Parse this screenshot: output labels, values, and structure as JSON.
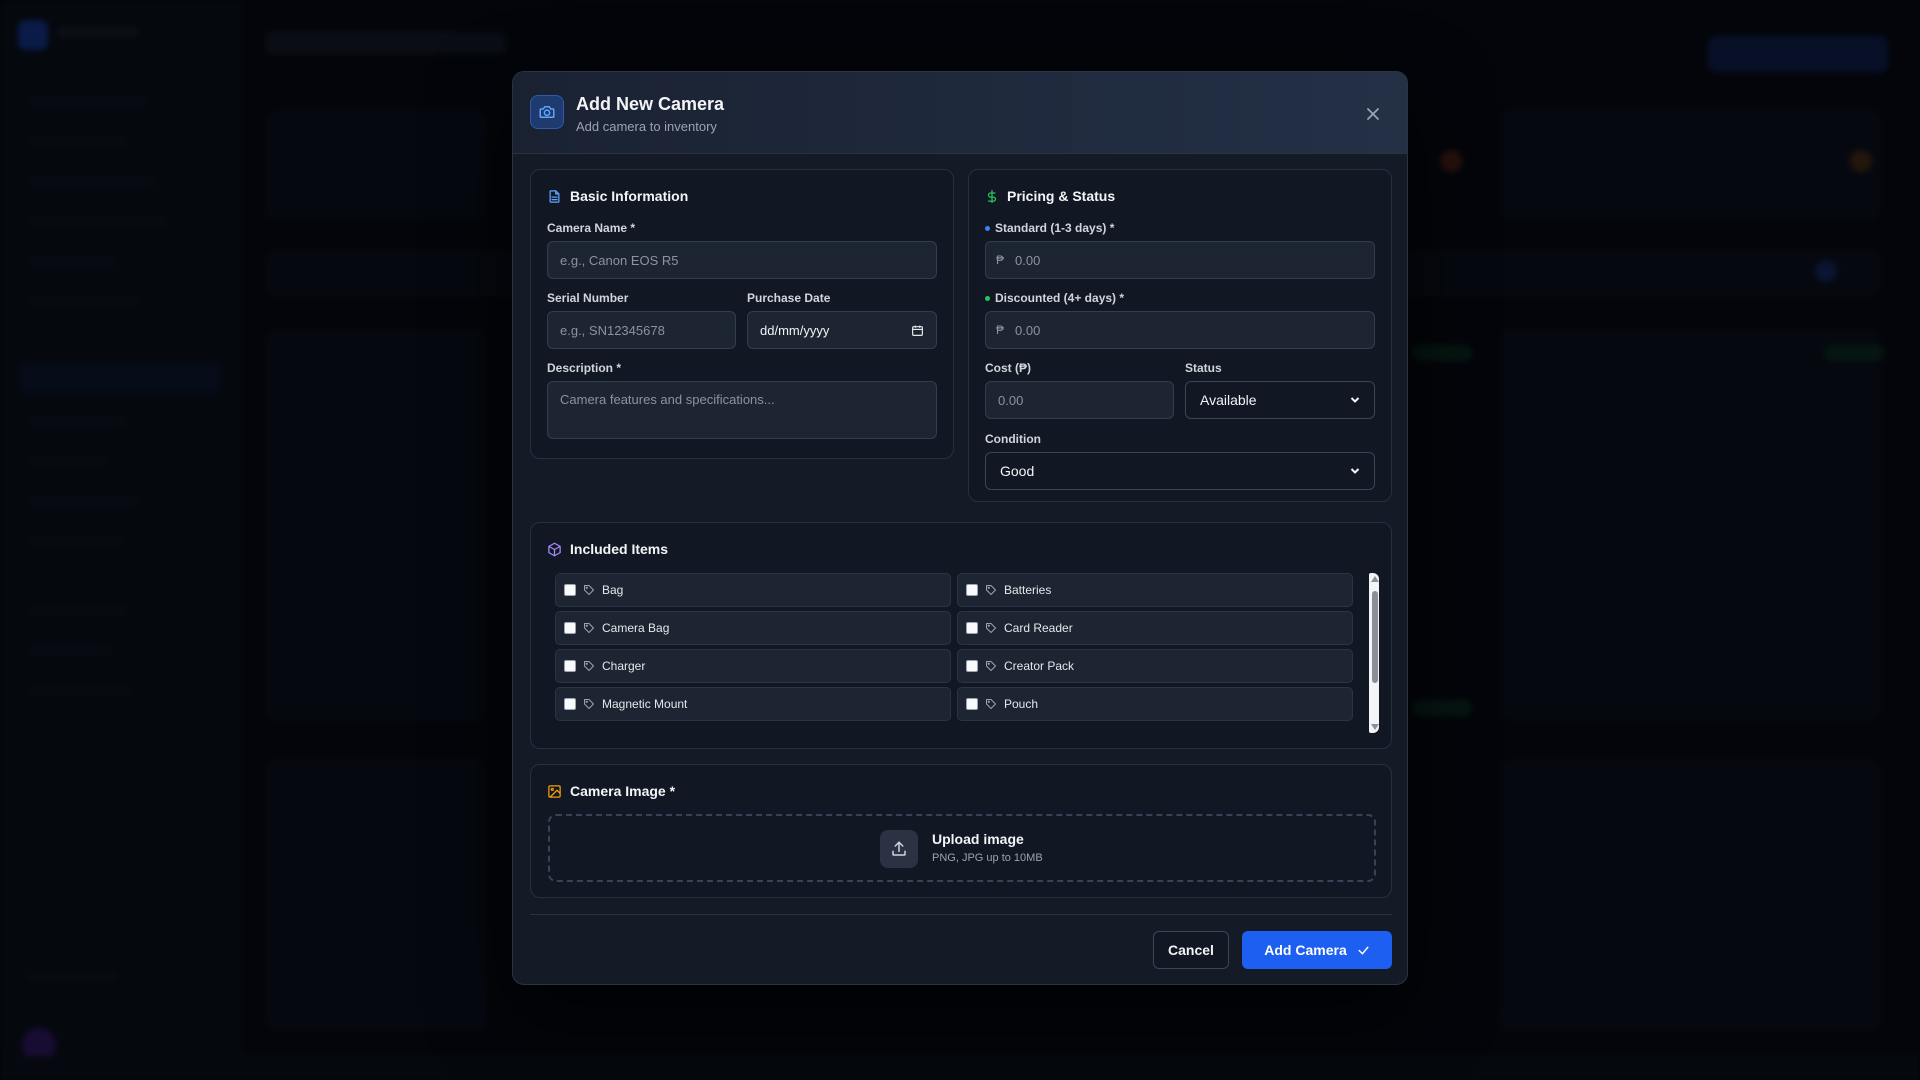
{
  "modal": {
    "title": "Add New Camera",
    "subtitle": "Add camera to inventory",
    "header_icon": "camera-icon",
    "close_icon": "close-icon"
  },
  "basic_info": {
    "title": "Basic Information",
    "icon": "document-icon",
    "camera_name": {
      "label": "Camera Name *",
      "placeholder": "e.g., Canon EOS R5",
      "value": ""
    },
    "serial_number": {
      "label": "Serial Number",
      "placeholder": "e.g., SN12345678",
      "value": ""
    },
    "purchase_date": {
      "label": "Purchase Date",
      "value": "dd/mm/yyyy",
      "icon": "calendar-icon"
    },
    "description": {
      "label": "Description *",
      "placeholder": "Camera features and specifications...",
      "value": ""
    }
  },
  "pricing": {
    "title": "Pricing & Status",
    "icon": "dollar-icon",
    "standard": {
      "label": "Standard (1-3 days) *",
      "placeholder": "0.00",
      "prefix": "₱",
      "dot_color": "#3b82f6"
    },
    "discounted": {
      "label": "Discounted (4+ days) *",
      "placeholder": "0.00",
      "prefix": "₱",
      "dot_color": "#22c55e"
    },
    "cost": {
      "label": "Cost (₱)",
      "placeholder": "0.00"
    },
    "status": {
      "label": "Status",
      "value": "Available"
    },
    "condition": {
      "label": "Condition",
      "value": "Good"
    }
  },
  "included_items": {
    "title": "Included Items",
    "icon": "package-icon",
    "items": [
      {
        "label": "Bag",
        "checked": false
      },
      {
        "label": "Batteries",
        "checked": false
      },
      {
        "label": "Camera Bag",
        "checked": false
      },
      {
        "label": "Card Reader",
        "checked": false
      },
      {
        "label": "Charger",
        "checked": false
      },
      {
        "label": "Creator Pack",
        "checked": false
      },
      {
        "label": "Magnetic Mount",
        "checked": false
      },
      {
        "label": "Pouch",
        "checked": false
      }
    ]
  },
  "camera_image": {
    "title": "Camera Image *",
    "icon": "image-icon",
    "upload_title": "Upload image",
    "upload_subtitle": "PNG, JPG up to 10MB",
    "upload_icon": "upload-icon"
  },
  "footer": {
    "cancel_label": "Cancel",
    "submit_label": "Add Camera",
    "submit_icon": "check-icon"
  },
  "colors": {
    "primary": "#1d5ff0",
    "pricing_icon": "#22c55e",
    "items_icon": "#a78bfa",
    "image_icon": "#f59e0b",
    "document_icon": "#60a5fa"
  }
}
